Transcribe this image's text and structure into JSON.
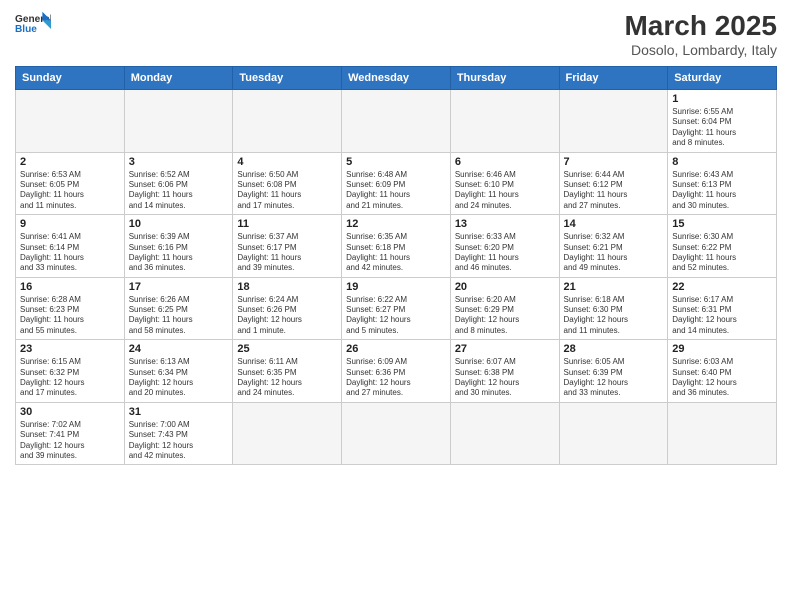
{
  "header": {
    "logo_general": "General",
    "logo_blue": "Blue",
    "title": "March 2025",
    "subtitle": "Dosolo, Lombardy, Italy"
  },
  "weekdays": [
    "Sunday",
    "Monday",
    "Tuesday",
    "Wednesday",
    "Thursday",
    "Friday",
    "Saturday"
  ],
  "weeks": [
    [
      {
        "day": "",
        "info": ""
      },
      {
        "day": "",
        "info": ""
      },
      {
        "day": "",
        "info": ""
      },
      {
        "day": "",
        "info": ""
      },
      {
        "day": "",
        "info": ""
      },
      {
        "day": "",
        "info": ""
      },
      {
        "day": "1",
        "info": "Sunrise: 6:55 AM\nSunset: 6:04 PM\nDaylight: 11 hours\nand 8 minutes."
      }
    ],
    [
      {
        "day": "2",
        "info": "Sunrise: 6:53 AM\nSunset: 6:05 PM\nDaylight: 11 hours\nand 11 minutes."
      },
      {
        "day": "3",
        "info": "Sunrise: 6:52 AM\nSunset: 6:06 PM\nDaylight: 11 hours\nand 14 minutes."
      },
      {
        "day": "4",
        "info": "Sunrise: 6:50 AM\nSunset: 6:08 PM\nDaylight: 11 hours\nand 17 minutes."
      },
      {
        "day": "5",
        "info": "Sunrise: 6:48 AM\nSunset: 6:09 PM\nDaylight: 11 hours\nand 21 minutes."
      },
      {
        "day": "6",
        "info": "Sunrise: 6:46 AM\nSunset: 6:10 PM\nDaylight: 11 hours\nand 24 minutes."
      },
      {
        "day": "7",
        "info": "Sunrise: 6:44 AM\nSunset: 6:12 PM\nDaylight: 11 hours\nand 27 minutes."
      },
      {
        "day": "8",
        "info": "Sunrise: 6:43 AM\nSunset: 6:13 PM\nDaylight: 11 hours\nand 30 minutes."
      }
    ],
    [
      {
        "day": "9",
        "info": "Sunrise: 6:41 AM\nSunset: 6:14 PM\nDaylight: 11 hours\nand 33 minutes."
      },
      {
        "day": "10",
        "info": "Sunrise: 6:39 AM\nSunset: 6:16 PM\nDaylight: 11 hours\nand 36 minutes."
      },
      {
        "day": "11",
        "info": "Sunrise: 6:37 AM\nSunset: 6:17 PM\nDaylight: 11 hours\nand 39 minutes."
      },
      {
        "day": "12",
        "info": "Sunrise: 6:35 AM\nSunset: 6:18 PM\nDaylight: 11 hours\nand 42 minutes."
      },
      {
        "day": "13",
        "info": "Sunrise: 6:33 AM\nSunset: 6:20 PM\nDaylight: 11 hours\nand 46 minutes."
      },
      {
        "day": "14",
        "info": "Sunrise: 6:32 AM\nSunset: 6:21 PM\nDaylight: 11 hours\nand 49 minutes."
      },
      {
        "day": "15",
        "info": "Sunrise: 6:30 AM\nSunset: 6:22 PM\nDaylight: 11 hours\nand 52 minutes."
      }
    ],
    [
      {
        "day": "16",
        "info": "Sunrise: 6:28 AM\nSunset: 6:23 PM\nDaylight: 11 hours\nand 55 minutes."
      },
      {
        "day": "17",
        "info": "Sunrise: 6:26 AM\nSunset: 6:25 PM\nDaylight: 11 hours\nand 58 minutes."
      },
      {
        "day": "18",
        "info": "Sunrise: 6:24 AM\nSunset: 6:26 PM\nDaylight: 12 hours\nand 1 minute."
      },
      {
        "day": "19",
        "info": "Sunrise: 6:22 AM\nSunset: 6:27 PM\nDaylight: 12 hours\nand 5 minutes."
      },
      {
        "day": "20",
        "info": "Sunrise: 6:20 AM\nSunset: 6:29 PM\nDaylight: 12 hours\nand 8 minutes."
      },
      {
        "day": "21",
        "info": "Sunrise: 6:18 AM\nSunset: 6:30 PM\nDaylight: 12 hours\nand 11 minutes."
      },
      {
        "day": "22",
        "info": "Sunrise: 6:17 AM\nSunset: 6:31 PM\nDaylight: 12 hours\nand 14 minutes."
      }
    ],
    [
      {
        "day": "23",
        "info": "Sunrise: 6:15 AM\nSunset: 6:32 PM\nDaylight: 12 hours\nand 17 minutes."
      },
      {
        "day": "24",
        "info": "Sunrise: 6:13 AM\nSunset: 6:34 PM\nDaylight: 12 hours\nand 20 minutes."
      },
      {
        "day": "25",
        "info": "Sunrise: 6:11 AM\nSunset: 6:35 PM\nDaylight: 12 hours\nand 24 minutes."
      },
      {
        "day": "26",
        "info": "Sunrise: 6:09 AM\nSunset: 6:36 PM\nDaylight: 12 hours\nand 27 minutes."
      },
      {
        "day": "27",
        "info": "Sunrise: 6:07 AM\nSunset: 6:38 PM\nDaylight: 12 hours\nand 30 minutes."
      },
      {
        "day": "28",
        "info": "Sunrise: 6:05 AM\nSunset: 6:39 PM\nDaylight: 12 hours\nand 33 minutes."
      },
      {
        "day": "29",
        "info": "Sunrise: 6:03 AM\nSunset: 6:40 PM\nDaylight: 12 hours\nand 36 minutes."
      }
    ],
    [
      {
        "day": "30",
        "info": "Sunrise: 7:02 AM\nSunset: 7:41 PM\nDaylight: 12 hours\nand 39 minutes."
      },
      {
        "day": "31",
        "info": "Sunrise: 7:00 AM\nSunset: 7:43 PM\nDaylight: 12 hours\nand 42 minutes."
      },
      {
        "day": "",
        "info": ""
      },
      {
        "day": "",
        "info": ""
      },
      {
        "day": "",
        "info": ""
      },
      {
        "day": "",
        "info": ""
      },
      {
        "day": "",
        "info": ""
      }
    ]
  ]
}
